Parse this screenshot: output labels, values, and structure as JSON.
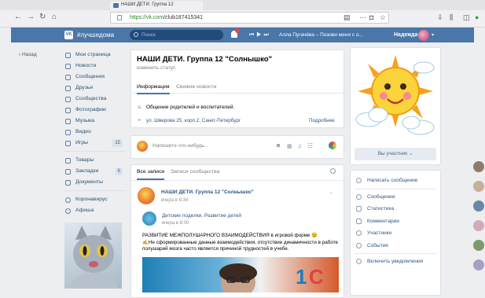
{
  "browser": {
    "tab_title": "НАШИ ДЕТИ. Группа 12",
    "url_host": "https://vk.com",
    "url_path": "/club187415341",
    "icons": [
      "back-icon",
      "forward-icon",
      "reload-icon",
      "home-icon",
      "bookmark-icon",
      "more-icon",
      "star-icon",
      "download-icon",
      "library-icon",
      "sidebar-icon"
    ]
  },
  "vk_header": {
    "logo": "VK",
    "site_name": "#лучшедома",
    "search_placeholder": "Поиск",
    "track": "Алла Пугачёва – Позови меня с о...",
    "user_name": "Надежда"
  },
  "left_menu": {
    "back_label": "Назад",
    "items": [
      {
        "label": "Мои страница"
      },
      {
        "label": "Новости"
      },
      {
        "label": "Сообщения"
      },
      {
        "label": "Друзья"
      },
      {
        "label": "Сообщества"
      },
      {
        "label": "Фотографии"
      },
      {
        "label": "Музыка"
      },
      {
        "label": "Видео"
      },
      {
        "label": "Игры",
        "count": "15"
      }
    ],
    "items2": [
      {
        "label": "Товары"
      },
      {
        "label": "Закладки",
        "count": "6"
      },
      {
        "label": "Документы"
      }
    ],
    "items3": [
      {
        "label": "Коронавирус"
      },
      {
        "label": "Афиша"
      }
    ]
  },
  "group": {
    "title": "НАШИ ДЕТИ. Группа 12 \"Солнышко\"",
    "status_hint": "изменить статус",
    "tabs": [
      "Информация",
      "Свежие новости"
    ],
    "description": "Общение родителей и воспитателей.",
    "address": "ул. Шверова 25, корп.2, Санкт-Петербург",
    "more_label": "Подробнее"
  },
  "composer": {
    "placeholder": "Напишите что-нибудь..."
  },
  "wall": {
    "tabs": [
      "Все записи",
      "Записи сообщества"
    ],
    "post": {
      "author": "НАШИ ДЕТИ. Группа 12 \"Солнышко\"",
      "date": "вчера в 8:34",
      "repost_author": "Детские поделки. Развитие детей",
      "repost_date": "вчера в 8:00",
      "text_line1": "РАЗВИТИЕ МЕЖПОЛУШАРНОГО ВЗАИМОДЕЙСТВИЯ в игровой форме 😉",
      "text_line2": "✍Не сформированные данные взаимодействия, отсутствие динамичности в работе полушарий мозга часто является причиной трудностей в учебе."
    }
  },
  "right": {
    "member_label": "Вы участник ⌄",
    "actions": [
      {
        "label": "Написать сообщение"
      }
    ],
    "links": [
      {
        "label": "Сообщения"
      },
      {
        "label": "Статистика"
      },
      {
        "label": "Комментарии"
      },
      {
        "label": "Участники"
      },
      {
        "label": "События"
      }
    ],
    "bottom": [
      {
        "label": "Включить уведомления"
      }
    ]
  },
  "colors": {
    "vk_blue": "#4a76a8",
    "link": "#2a5885",
    "bg": "#edeef0"
  }
}
